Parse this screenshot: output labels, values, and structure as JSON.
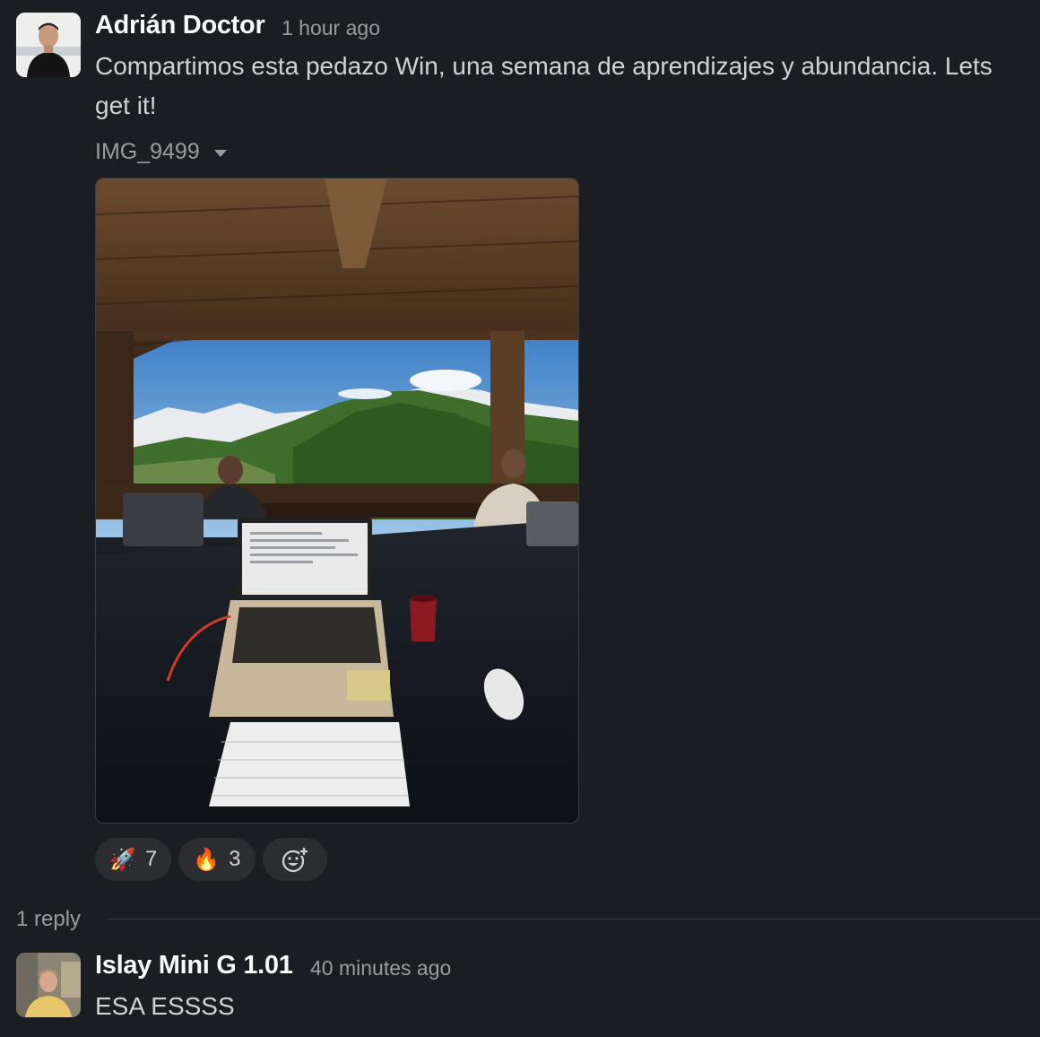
{
  "message": {
    "author": "Adrián Doctor",
    "timestamp": "1 hour ago",
    "text_line1": "Compartimos esta pedazo Win, una semana de aprendizajes y abundancia. Lets",
    "text_line2": "get it!",
    "attachment": {
      "filename": "IMG_9499",
      "icon": "chevron-down-icon"
    },
    "reactions": [
      {
        "emoji": "🚀",
        "icon": "rocket-emoji",
        "count": "7"
      },
      {
        "emoji": "🔥",
        "icon": "fire-emoji",
        "count": "3"
      }
    ],
    "add_reaction_icon": "add-reaction-icon"
  },
  "thread": {
    "reply_count": "1 reply"
  },
  "reply": {
    "author": "Islay Mini G 1.01",
    "timestamp": "40 minutes ago",
    "text": "ESA ESSSS"
  },
  "colors": {
    "background": "#1a1d21",
    "text": "#d1d2d3",
    "muted": "#9b9c9e",
    "pill": "#2b2d31"
  }
}
